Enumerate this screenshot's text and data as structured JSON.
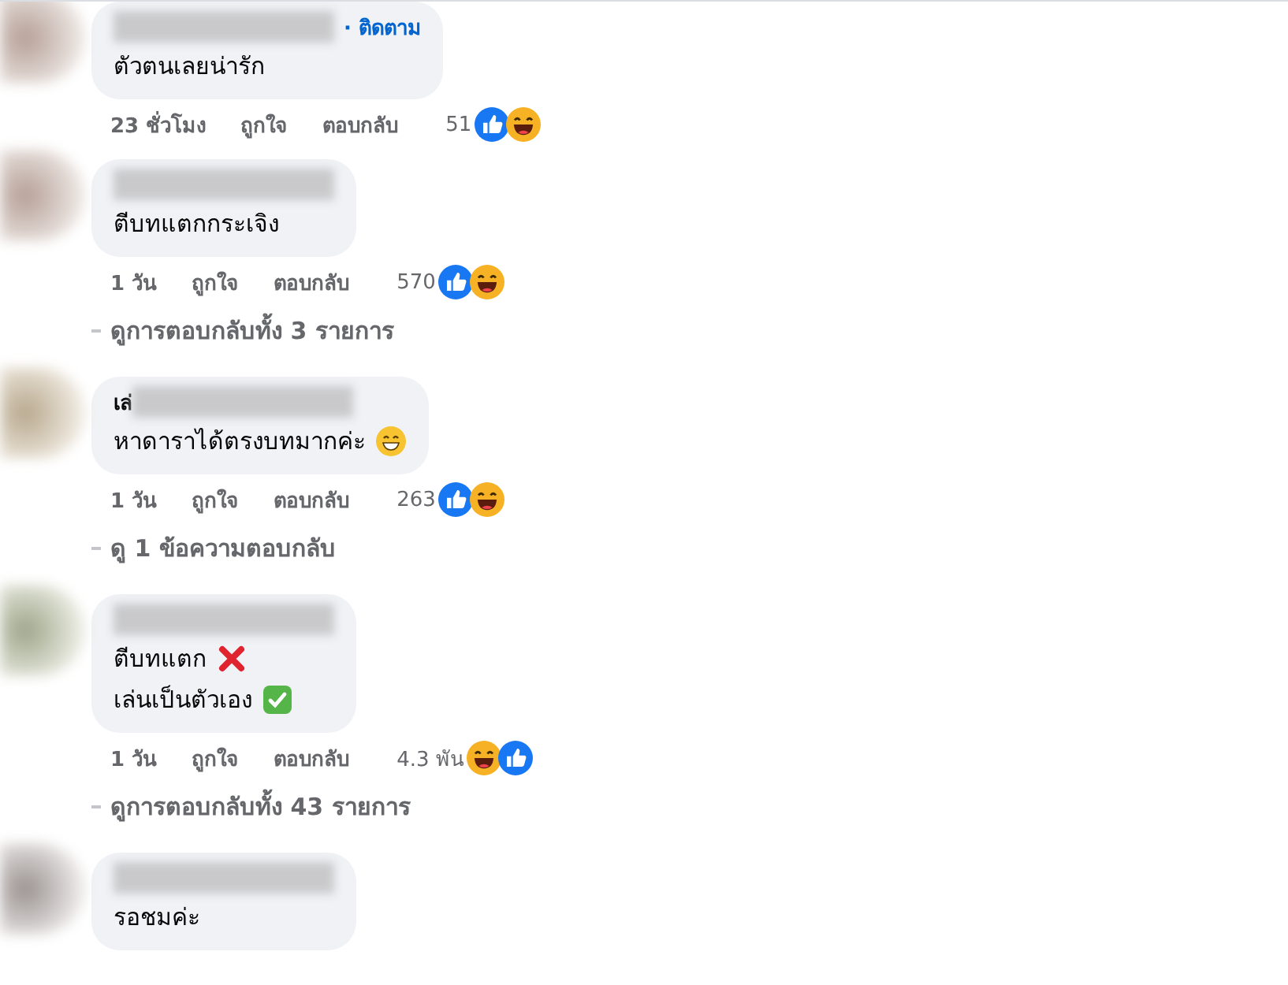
{
  "comments": [
    {
      "author": {
        "follow": "· ติดตาม"
      },
      "lines": [
        {
          "kind": "plain",
          "text": "ตัวตนเลยน่ารัก"
        }
      ],
      "time": "23 ชั่วโมง",
      "like": "ถูกใจ",
      "reply": "ตอบกลับ",
      "count": "51",
      "reactions": [
        {
          "kind": "like"
        },
        {
          "kind": "haha"
        }
      ]
    },
    {
      "lines": [
        {
          "kind": "plain",
          "text": "ตีบทแตกกระเจิง"
        }
      ],
      "time": "1 วัน",
      "like": "ถูกใจ",
      "reply": "ตอบกลับ",
      "count": "570",
      "reactions": [
        {
          "kind": "like"
        },
        {
          "kind": "haha"
        }
      ],
      "more": "ดูการตอบกลับทั้ง 3 รายการ"
    },
    {
      "author": {
        "visible": "เล่"
      },
      "lines": [
        {
          "kind": "grin",
          "text": "หาดาราได้ตรงบทมากค่ะ"
        }
      ],
      "time": "1 วัน",
      "like": "ถูกใจ",
      "reply": "ตอบกลับ",
      "count": "263",
      "reactions": [
        {
          "kind": "like"
        },
        {
          "kind": "haha"
        }
      ],
      "more": "ดู 1 ข้อความตอบกลับ"
    },
    {
      "lines": [
        {
          "kind": "cross",
          "text": "ตีบทแตก"
        },
        {
          "kind": "check",
          "text": "เล่นเป็นตัวเอง"
        }
      ],
      "time": "1 วัน",
      "like": "ถูกใจ",
      "reply": "ตอบกลับ",
      "count": "4.3 พัน",
      "reactions": [
        {
          "kind": "haha"
        },
        {
          "kind": "like"
        }
      ],
      "more": "ดูการตอบกลับทั้ง 43 รายการ"
    },
    {
      "lines": [
        {
          "kind": "plain",
          "text": "รอชมค่ะ"
        }
      ]
    }
  ]
}
